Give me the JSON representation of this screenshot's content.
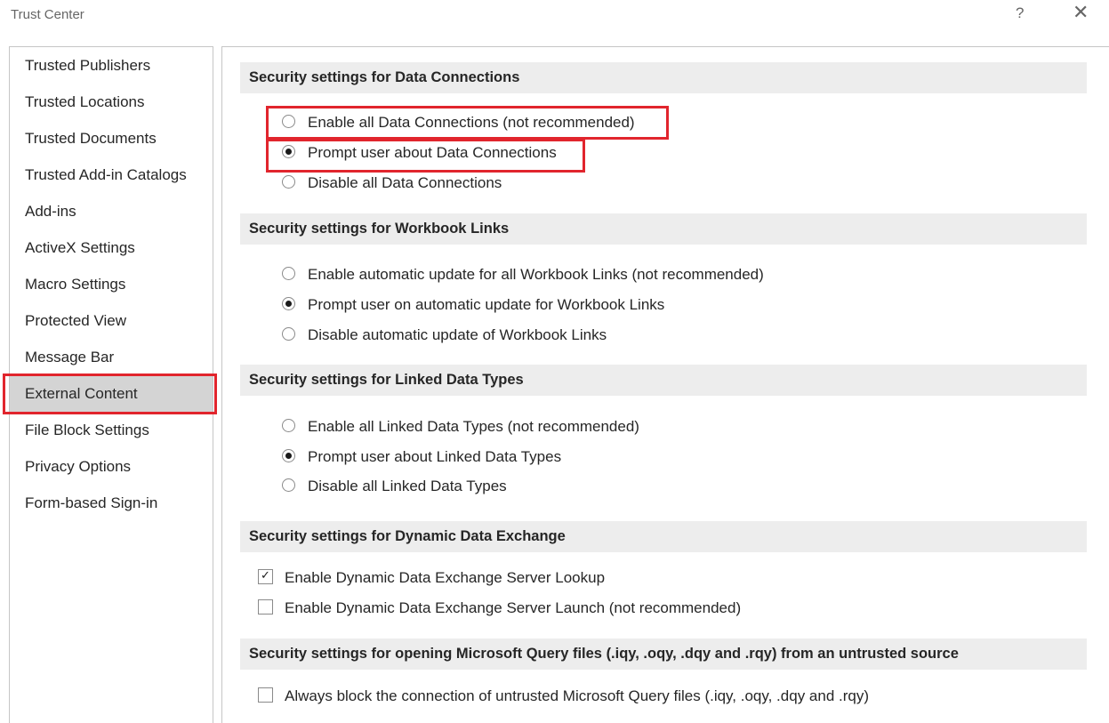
{
  "window": {
    "title": "Trust Center",
    "help_label": "?",
    "close_label": "✕"
  },
  "sidebar": {
    "items": [
      {
        "label": "Trusted Publishers",
        "selected": false
      },
      {
        "label": "Trusted Locations",
        "selected": false
      },
      {
        "label": "Trusted Documents",
        "selected": false
      },
      {
        "label": "Trusted Add-in Catalogs",
        "selected": false
      },
      {
        "label": "Add-ins",
        "selected": false
      },
      {
        "label": "ActiveX Settings",
        "selected": false
      },
      {
        "label": "Macro Settings",
        "selected": false
      },
      {
        "label": "Protected View",
        "selected": false
      },
      {
        "label": "Message Bar",
        "selected": false
      },
      {
        "label": "External Content",
        "selected": true
      },
      {
        "label": "File Block Settings",
        "selected": false
      },
      {
        "label": "Privacy Options",
        "selected": false
      },
      {
        "label": "Form-based Sign-in",
        "selected": false
      }
    ]
  },
  "sections": {
    "data_connections": {
      "header": "Security settings for Data Connections",
      "options": [
        {
          "label": "Enable all Data Connections (not recommended)",
          "checked": false
        },
        {
          "label": "Prompt user about Data Connections",
          "checked": true
        },
        {
          "label": "Disable all Data Connections",
          "checked": false
        }
      ]
    },
    "workbook_links": {
      "header": "Security settings for Workbook Links",
      "options": [
        {
          "label": "Enable automatic update for all Workbook Links (not recommended)",
          "checked": false
        },
        {
          "label": "Prompt user on automatic update for Workbook Links",
          "checked": true
        },
        {
          "label": "Disable automatic update of Workbook Links",
          "checked": false
        }
      ]
    },
    "linked_data_types": {
      "header": "Security settings for Linked Data Types",
      "options": [
        {
          "label": "Enable all Linked Data Types (not recommended)",
          "checked": false
        },
        {
          "label": "Prompt user about Linked Data Types",
          "checked": true
        },
        {
          "label": "Disable all Linked Data Types",
          "checked": false
        }
      ]
    },
    "dde": {
      "header": "Security settings for Dynamic Data Exchange",
      "options": [
        {
          "label": "Enable Dynamic Data Exchange Server Lookup",
          "checked": true
        },
        {
          "label": "Enable Dynamic Data Exchange Server Launch (not recommended)",
          "checked": false
        }
      ]
    },
    "query_files": {
      "header": "Security settings for opening  Microsoft Query files (.iqy, .oqy, .dqy and .rqy) from an untrusted source",
      "options": [
        {
          "label": "Always block the connection of untrusted Microsoft Query files (.iqy, .oqy, .dqy and .rqy)",
          "checked": false
        }
      ]
    }
  },
  "colors": {
    "highlight_red": "#e1252d",
    "selected_bg": "#d4d4d4",
    "section_bg": "#ededed"
  }
}
